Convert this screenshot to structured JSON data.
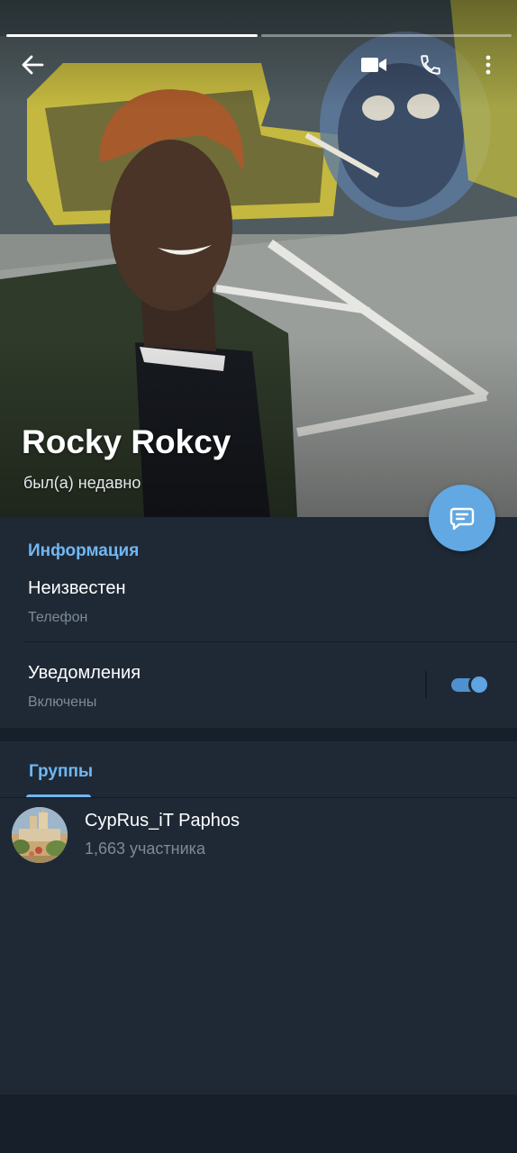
{
  "story": {
    "segments": 2,
    "active_segment": 1
  },
  "header": {
    "back_icon": "arrow-left-icon",
    "actions": [
      {
        "name": "video-call",
        "icon": "video-camera-icon"
      },
      {
        "name": "voice-call",
        "icon": "phone-icon"
      },
      {
        "name": "more",
        "icon": "more-vertical-icon"
      }
    ]
  },
  "profile": {
    "name": "Rocky Rokcy",
    "status": "был(а) недавно"
  },
  "fab": {
    "icon": "message-icon",
    "color": "#62a8e2"
  },
  "info": {
    "title": "Информация",
    "phone_value": "Неизвестен",
    "phone_label": "Телефон",
    "notifications_title": "Уведомления",
    "notifications_state": "Включены",
    "notifications_enabled": true
  },
  "groups": {
    "tab_label": "Группы",
    "items": [
      {
        "title": "CypRus_iT Paphos",
        "members": "1,663 участника"
      }
    ]
  },
  "colors": {
    "background": "#1d2733",
    "panel": "#1f2936",
    "accent": "#71b7f2",
    "muted_text": "#7c8a98"
  }
}
